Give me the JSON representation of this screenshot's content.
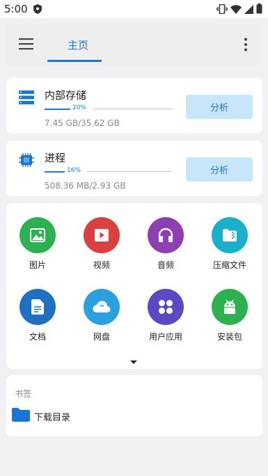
{
  "status_bar": {
    "time": "5:00"
  },
  "toolbar": {
    "tab_home": "主页"
  },
  "storage": {
    "label": "内部存储",
    "percent_label": "20%",
    "percent": 0.2,
    "detail": "7.45 GB/35.62 GB",
    "analyze_label": "分析"
  },
  "process": {
    "label": "进程",
    "percent_label": "16%",
    "percent": 0.16,
    "detail": "508.36 MB/2.93 GB",
    "analyze_label": "分析"
  },
  "categories": [
    {
      "label": "图片",
      "icon": "image-icon",
      "color": "#2db04f"
    },
    {
      "label": "视频",
      "icon": "video-icon",
      "color": "#d94141"
    },
    {
      "label": "音频",
      "icon": "headphones-icon",
      "color": "#8e3fb2"
    },
    {
      "label": "压缩文件",
      "icon": "archive-icon",
      "color": "#1bb0c9"
    },
    {
      "label": "文档",
      "icon": "document-icon",
      "color": "#1f6fc2"
    },
    {
      "label": "网盘",
      "icon": "cloud-icon",
      "color": "#2c9fe0"
    },
    {
      "label": "用户应用",
      "icon": "apps-icon",
      "color": "#5a48c4"
    },
    {
      "label": "安装包",
      "icon": "android-icon",
      "color": "#2db04f"
    }
  ],
  "bookmarks": {
    "title": "书签",
    "items": [
      {
        "label": "下载目录",
        "icon": "folder-icon",
        "color": "#1976d2"
      }
    ]
  }
}
